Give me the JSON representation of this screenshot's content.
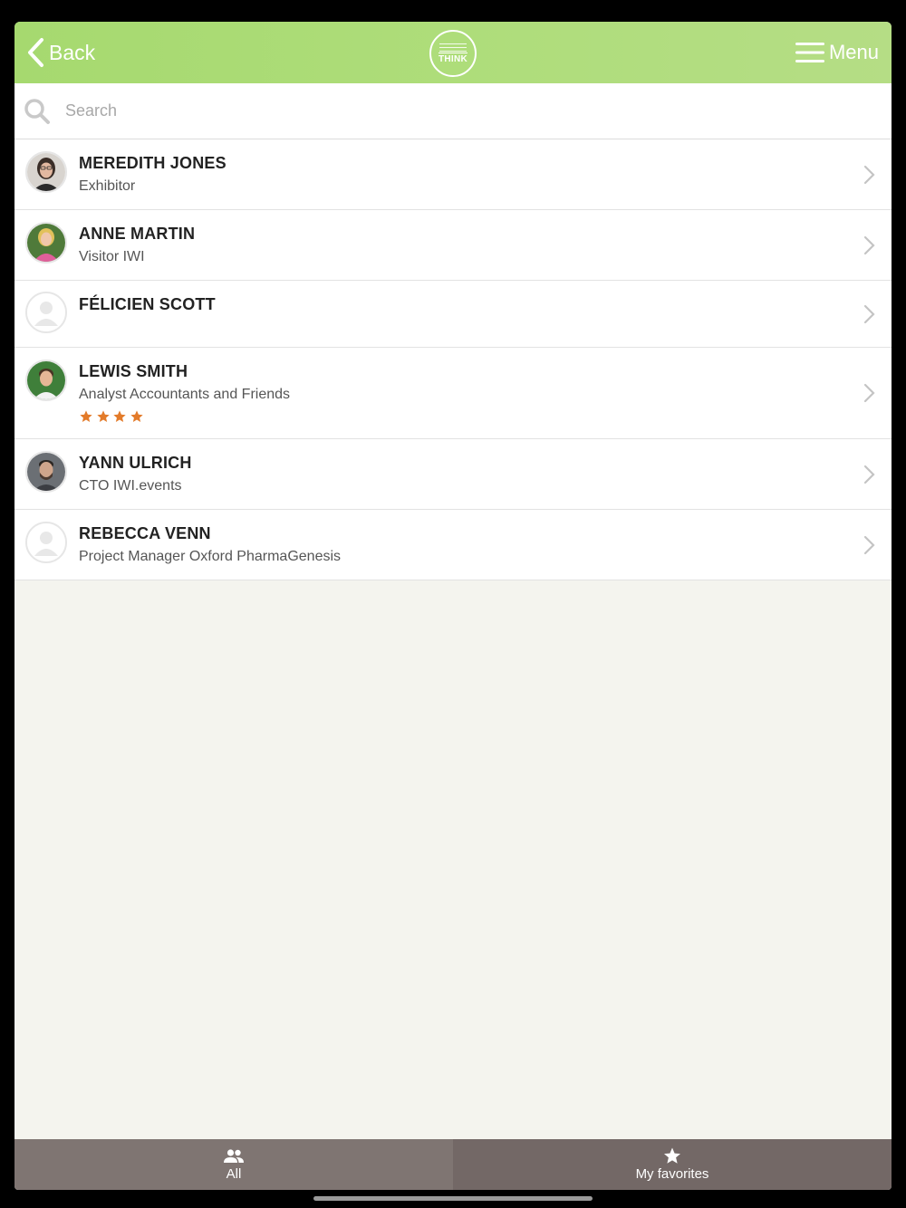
{
  "header": {
    "back_label": "Back",
    "logo_text": "THINK",
    "menu_label": "Menu",
    "accent": "#a6d96f"
  },
  "search": {
    "placeholder": "Search",
    "value": ""
  },
  "people": [
    {
      "name": "MEREDITH JONES",
      "subtitle": "Exhibitor",
      "avatar": "photo-woman-dark-hair",
      "rating": 0
    },
    {
      "name": "ANNE MARTIN",
      "subtitle": "Visitor IWI",
      "avatar": "photo-woman-blonde",
      "rating": 0
    },
    {
      "name": "FÉLICIEN SCOTT",
      "subtitle": "",
      "avatar": "placeholder-avatar",
      "rating": 0
    },
    {
      "name": "LEWIS SMITH",
      "subtitle": "Analyst Accountants and Friends",
      "avatar": "photo-man-outdoor",
      "rating": 4
    },
    {
      "name": "YANN ULRICH",
      "subtitle": "CTO IWI.events",
      "avatar": "photo-man-beard",
      "rating": 0
    },
    {
      "name": "REBECCA VENN",
      "subtitle": "Project Manager Oxford PharmaGenesis",
      "avatar": "placeholder-avatar",
      "rating": 0
    }
  ],
  "tabs": [
    {
      "label": "All",
      "icon": "people-icon",
      "active": true
    },
    {
      "label": "My favorites",
      "icon": "star-icon",
      "active": false
    }
  ],
  "colors": {
    "star": "#e37b2a",
    "tab_all": "#7f7572",
    "tab_fav": "#736866",
    "background": "#f4f4ee"
  }
}
